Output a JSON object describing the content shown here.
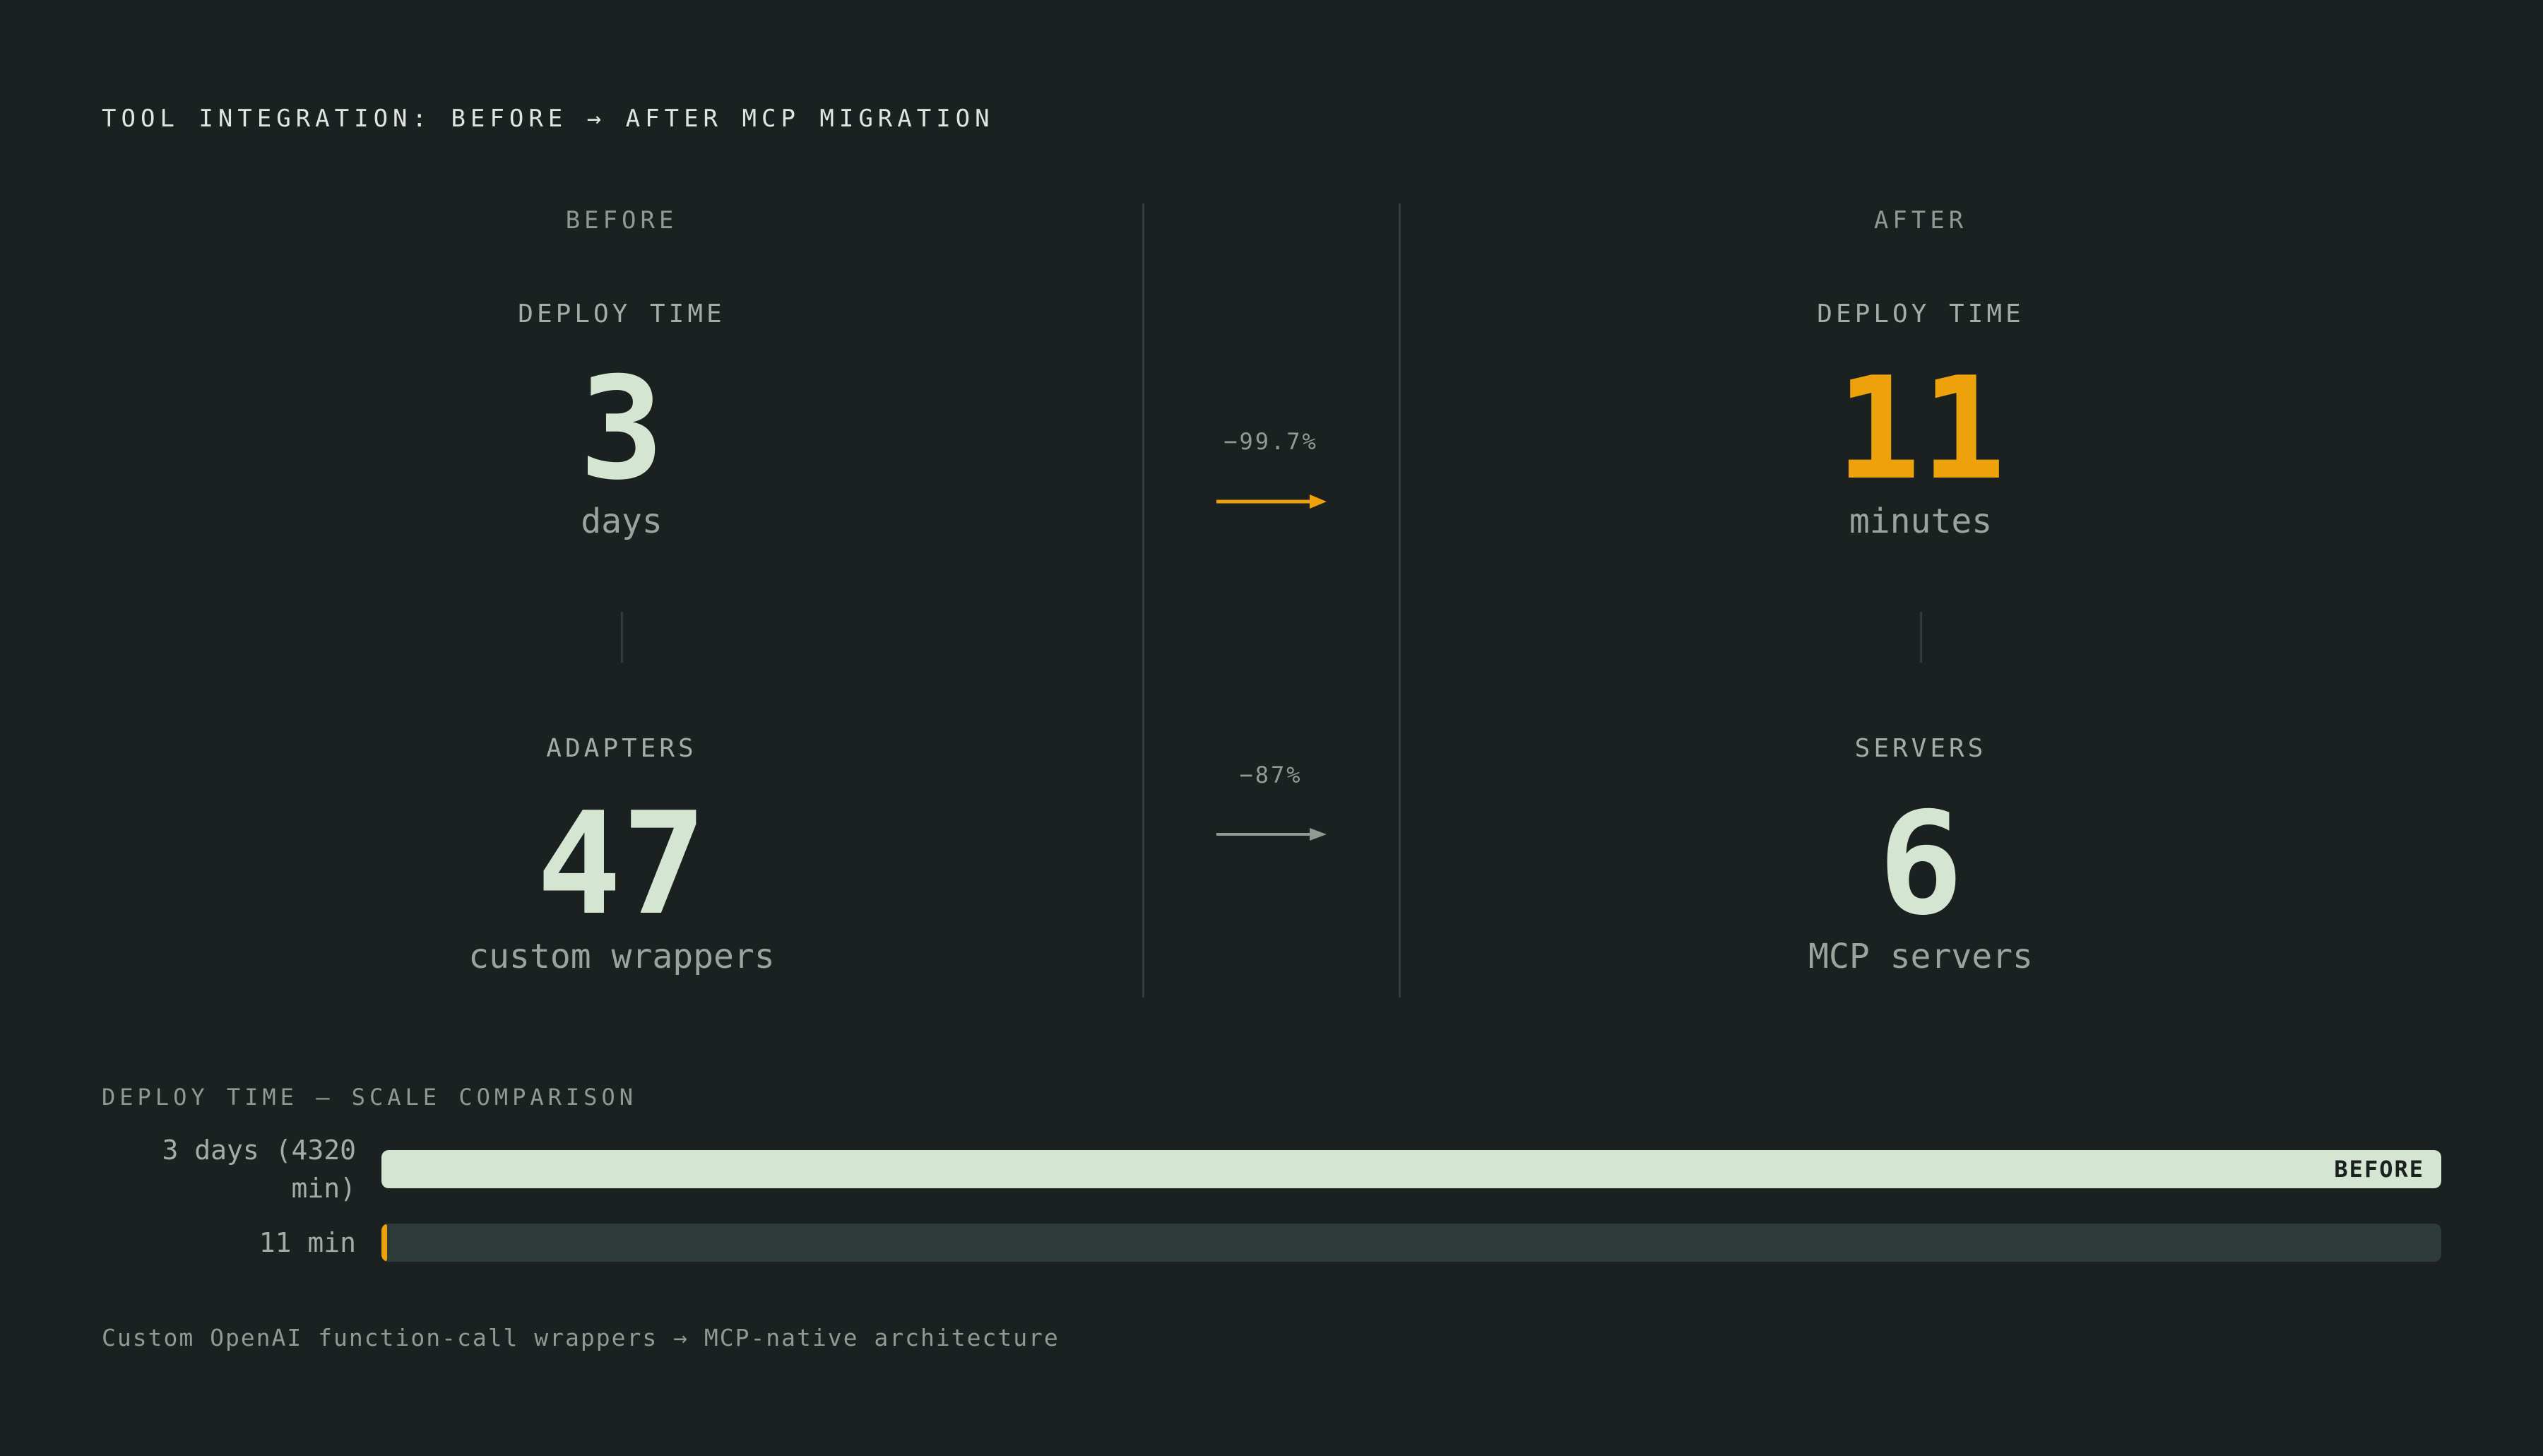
{
  "title": "TOOL INTEGRATION: BEFORE → AFTER MCP MIGRATION",
  "columns": {
    "before": "BEFORE",
    "after": "AFTER"
  },
  "metrics": {
    "deploy": {
      "before_label": "DEPLOY TIME",
      "before_value": "3",
      "before_unit": "days",
      "after_label": "DEPLOY TIME",
      "after_value": "11",
      "after_unit": "minutes",
      "change": "−99.7%"
    },
    "integration": {
      "before_label": "ADAPTERS",
      "before_value": "47",
      "before_unit": "custom wrappers",
      "after_label": "SERVERS",
      "after_value": "6",
      "after_unit": "MCP servers",
      "change": "−87%"
    }
  },
  "scale": {
    "title": "DEPLOY TIME — SCALE COMPARISON",
    "bars": [
      {
        "label_line1": "3 days (4320",
        "label_line2": "min)",
        "tag": "BEFORE"
      },
      {
        "label_line1": "11 min",
        "label_line2": "",
        "tag": ""
      }
    ]
  },
  "footer": "Custom OpenAI function-call wrappers → MCP-native architecture",
  "colors": {
    "background": "#1b2020",
    "before_value": "#d4e6d2",
    "after_accent": "#eda20c",
    "track": "#2e3b39",
    "muted": "#8f9a93"
  },
  "chart_data": {
    "type": "bar",
    "title": "DEPLOY TIME — SCALE COMPARISON",
    "orientation": "horizontal",
    "categories": [
      "3 days (4320 min)",
      "11 min"
    ],
    "values": [
      4320,
      11
    ],
    "unit": "min",
    "xlim": [
      0,
      4320
    ],
    "colors": [
      "#d4e6d2",
      "#eda20c"
    ]
  }
}
